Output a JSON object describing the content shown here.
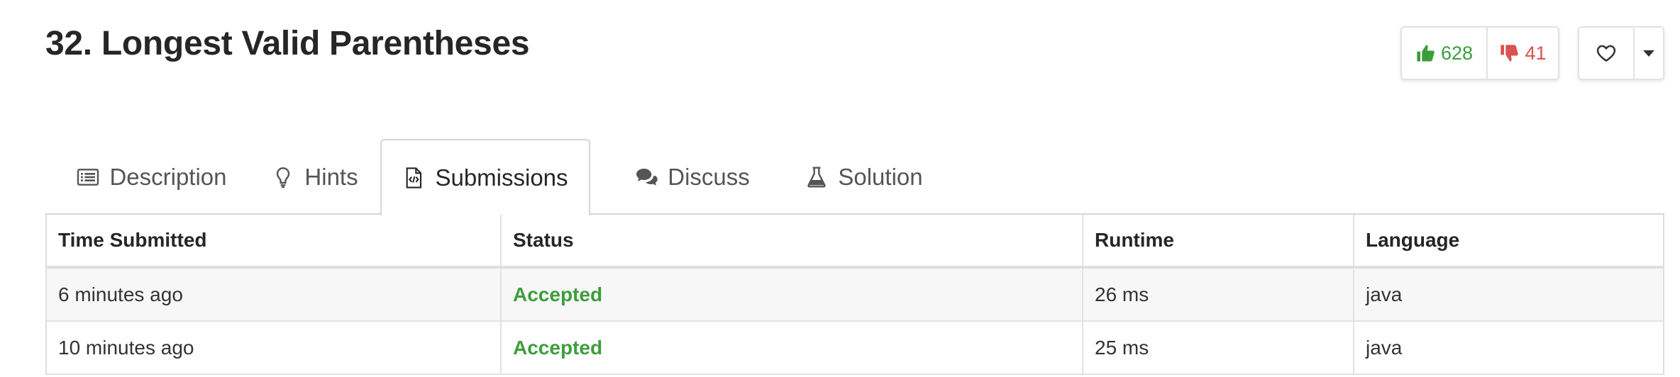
{
  "problem": {
    "title": "32. Longest Valid Parentheses"
  },
  "votes": {
    "up_count": "628",
    "down_count": "41"
  },
  "tabs": [
    {
      "label": "Description",
      "icon": "list-icon"
    },
    {
      "label": "Hints",
      "icon": "lightbulb-icon"
    },
    {
      "label": "Submissions",
      "icon": "code-file-icon",
      "active": true
    },
    {
      "label": "Discuss",
      "icon": "comments-icon"
    },
    {
      "label": "Solution",
      "icon": "flask-icon"
    }
  ],
  "table": {
    "headers": [
      "Time Submitted",
      "Status",
      "Runtime",
      "Language"
    ],
    "rows": [
      {
        "time": "6 minutes ago",
        "status": "Accepted",
        "runtime": "26 ms",
        "language": "java"
      },
      {
        "time": "10 minutes ago",
        "status": "Accepted",
        "runtime": "25 ms",
        "language": "java"
      }
    ]
  },
  "colors": {
    "accepted": "#3c9e3b",
    "downvote": "#d9534f",
    "border": "#d6d6d6"
  }
}
